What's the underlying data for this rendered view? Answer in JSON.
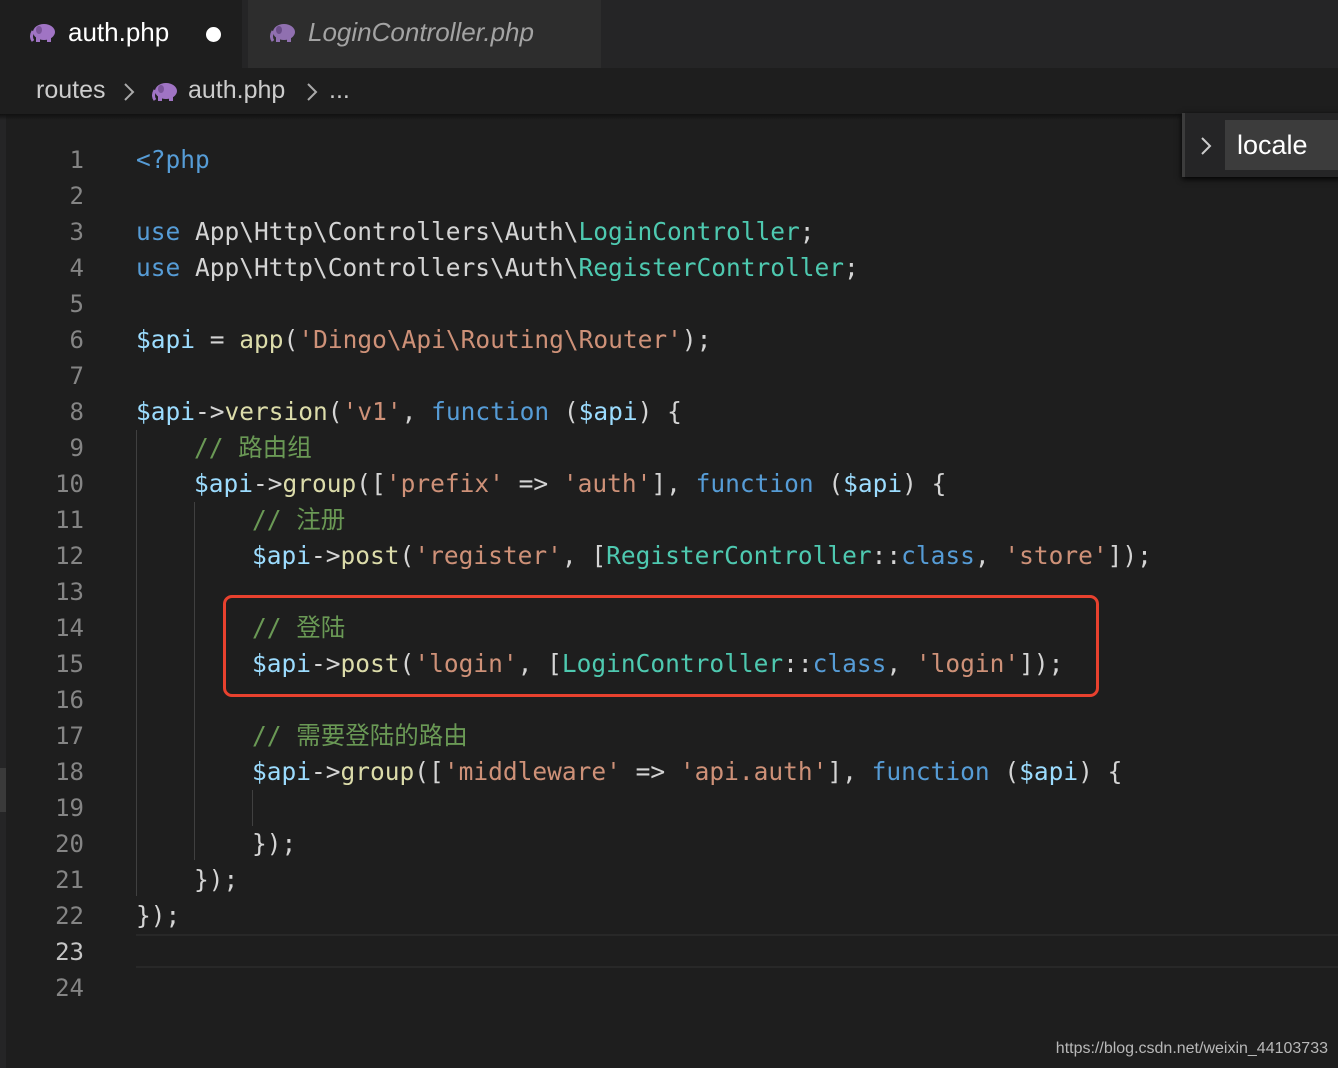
{
  "tabs": [
    {
      "label": "auth.php",
      "icon": "php-elephant-icon",
      "modified": true,
      "active": true
    },
    {
      "label": "LoginController.php",
      "icon": "php-elephant-icon",
      "active": false
    }
  ],
  "breadcrumb": {
    "folder": "routes",
    "file": "auth.php",
    "ellipsis": "..."
  },
  "sticky_scroll": {
    "label": "locale"
  },
  "editor": {
    "current_line": 23,
    "highlighted_lines": [
      14,
      15
    ],
    "lines": [
      {
        "n": 1,
        "indent": 0,
        "tokens": [
          {
            "t": "<?php",
            "c": "kw"
          }
        ]
      },
      {
        "n": 2,
        "indent": 0,
        "tokens": []
      },
      {
        "n": 3,
        "indent": 0,
        "tokens": [
          {
            "t": "use",
            "c": "kw"
          },
          {
            "t": " App\\Http\\Controllers\\Auth\\",
            "c": "pun"
          },
          {
            "t": "LoginController",
            "c": "cls"
          },
          {
            "t": ";",
            "c": "pun"
          }
        ]
      },
      {
        "n": 4,
        "indent": 0,
        "tokens": [
          {
            "t": "use",
            "c": "kw"
          },
          {
            "t": " App\\Http\\Controllers\\Auth\\",
            "c": "pun"
          },
          {
            "t": "RegisterController",
            "c": "cls"
          },
          {
            "t": ";",
            "c": "pun"
          }
        ]
      },
      {
        "n": 5,
        "indent": 0,
        "tokens": []
      },
      {
        "n": 6,
        "indent": 0,
        "tokens": [
          {
            "t": "$api",
            "c": "var"
          },
          {
            "t": " = ",
            "c": "pun"
          },
          {
            "t": "app",
            "c": "fn"
          },
          {
            "t": "(",
            "c": "pun"
          },
          {
            "t": "'Dingo\\Api\\Routing\\Router'",
            "c": "str"
          },
          {
            "t": ");",
            "c": "pun"
          }
        ]
      },
      {
        "n": 7,
        "indent": 0,
        "tokens": []
      },
      {
        "n": 8,
        "indent": 0,
        "tokens": [
          {
            "t": "$api",
            "c": "var"
          },
          {
            "t": "->",
            "c": "pun"
          },
          {
            "t": "version",
            "c": "fn"
          },
          {
            "t": "(",
            "c": "pun"
          },
          {
            "t": "'v1'",
            "c": "str"
          },
          {
            "t": ", ",
            "c": "pun"
          },
          {
            "t": "function",
            "c": "kw"
          },
          {
            "t": " (",
            "c": "pun"
          },
          {
            "t": "$api",
            "c": "var"
          },
          {
            "t": ") {",
            "c": "pun"
          }
        ]
      },
      {
        "n": 9,
        "indent": 1,
        "tokens": [
          {
            "t": "// 路由组",
            "c": "cmt"
          }
        ]
      },
      {
        "n": 10,
        "indent": 1,
        "tokens": [
          {
            "t": "$api",
            "c": "var"
          },
          {
            "t": "->",
            "c": "pun"
          },
          {
            "t": "group",
            "c": "fn"
          },
          {
            "t": "([",
            "c": "pun"
          },
          {
            "t": "'prefix'",
            "c": "str"
          },
          {
            "t": " => ",
            "c": "pun"
          },
          {
            "t": "'auth'",
            "c": "str"
          },
          {
            "t": "], ",
            "c": "pun"
          },
          {
            "t": "function",
            "c": "kw"
          },
          {
            "t": " (",
            "c": "pun"
          },
          {
            "t": "$api",
            "c": "var"
          },
          {
            "t": ") {",
            "c": "pun"
          }
        ]
      },
      {
        "n": 11,
        "indent": 2,
        "tokens": [
          {
            "t": "// 注册",
            "c": "cmt"
          }
        ]
      },
      {
        "n": 12,
        "indent": 2,
        "tokens": [
          {
            "t": "$api",
            "c": "var"
          },
          {
            "t": "->",
            "c": "pun"
          },
          {
            "t": "post",
            "c": "fn"
          },
          {
            "t": "(",
            "c": "pun"
          },
          {
            "t": "'register'",
            "c": "str"
          },
          {
            "t": ", [",
            "c": "pun"
          },
          {
            "t": "RegisterController",
            "c": "cls"
          },
          {
            "t": "::",
            "c": "pun"
          },
          {
            "t": "class",
            "c": "kw"
          },
          {
            "t": ", ",
            "c": "pun"
          },
          {
            "t": "'store'",
            "c": "str"
          },
          {
            "t": "]);",
            "c": "pun"
          }
        ]
      },
      {
        "n": 13,
        "indent": 2,
        "tokens": []
      },
      {
        "n": 14,
        "indent": 2,
        "tokens": [
          {
            "t": "// 登陆",
            "c": "cmt"
          }
        ]
      },
      {
        "n": 15,
        "indent": 2,
        "tokens": [
          {
            "t": "$api",
            "c": "var"
          },
          {
            "t": "->",
            "c": "pun"
          },
          {
            "t": "post",
            "c": "fn"
          },
          {
            "t": "(",
            "c": "pun"
          },
          {
            "t": "'login'",
            "c": "str"
          },
          {
            "t": ", [",
            "c": "pun"
          },
          {
            "t": "LoginController",
            "c": "cls"
          },
          {
            "t": "::",
            "c": "pun"
          },
          {
            "t": "class",
            "c": "kw"
          },
          {
            "t": ", ",
            "c": "pun"
          },
          {
            "t": "'login'",
            "c": "str"
          },
          {
            "t": "]);",
            "c": "pun"
          }
        ]
      },
      {
        "n": 16,
        "indent": 2,
        "tokens": []
      },
      {
        "n": 17,
        "indent": 2,
        "tokens": [
          {
            "t": "// 需要登陆的路由",
            "c": "cmt"
          }
        ]
      },
      {
        "n": 18,
        "indent": 2,
        "tokens": [
          {
            "t": "$api",
            "c": "var"
          },
          {
            "t": "->",
            "c": "pun"
          },
          {
            "t": "group",
            "c": "fn"
          },
          {
            "t": "([",
            "c": "pun"
          },
          {
            "t": "'middleware'",
            "c": "str"
          },
          {
            "t": " => ",
            "c": "pun"
          },
          {
            "t": "'api.auth'",
            "c": "str"
          },
          {
            "t": "], ",
            "c": "pun"
          },
          {
            "t": "function",
            "c": "kw"
          },
          {
            "t": " (",
            "c": "pun"
          },
          {
            "t": "$api",
            "c": "var"
          },
          {
            "t": ") {",
            "c": "pun"
          }
        ]
      },
      {
        "n": 19,
        "indent": 2,
        "tokens": []
      },
      {
        "n": 20,
        "indent": 2,
        "tokens": [
          {
            "t": "});",
            "c": "pun"
          }
        ]
      },
      {
        "n": 21,
        "indent": 1,
        "tokens": [
          {
            "t": "});",
            "c": "pun"
          }
        ]
      },
      {
        "n": 22,
        "indent": 0,
        "tokens": [
          {
            "t": "});",
            "c": "pun"
          }
        ]
      },
      {
        "n": 23,
        "indent": 0,
        "tokens": []
      },
      {
        "n": 24,
        "indent": 0,
        "tokens": []
      }
    ]
  },
  "colors": {
    "keyword": "#569cd6",
    "variable": "#9cdcfe",
    "function": "#dcdcaa",
    "string": "#ce9178",
    "class": "#4ec9b0",
    "comment": "#6a9955",
    "highlight_border": "#e8412e",
    "php_icon": "#a074c4"
  },
  "watermark": "https://blog.csdn.net/weixin_44103733"
}
